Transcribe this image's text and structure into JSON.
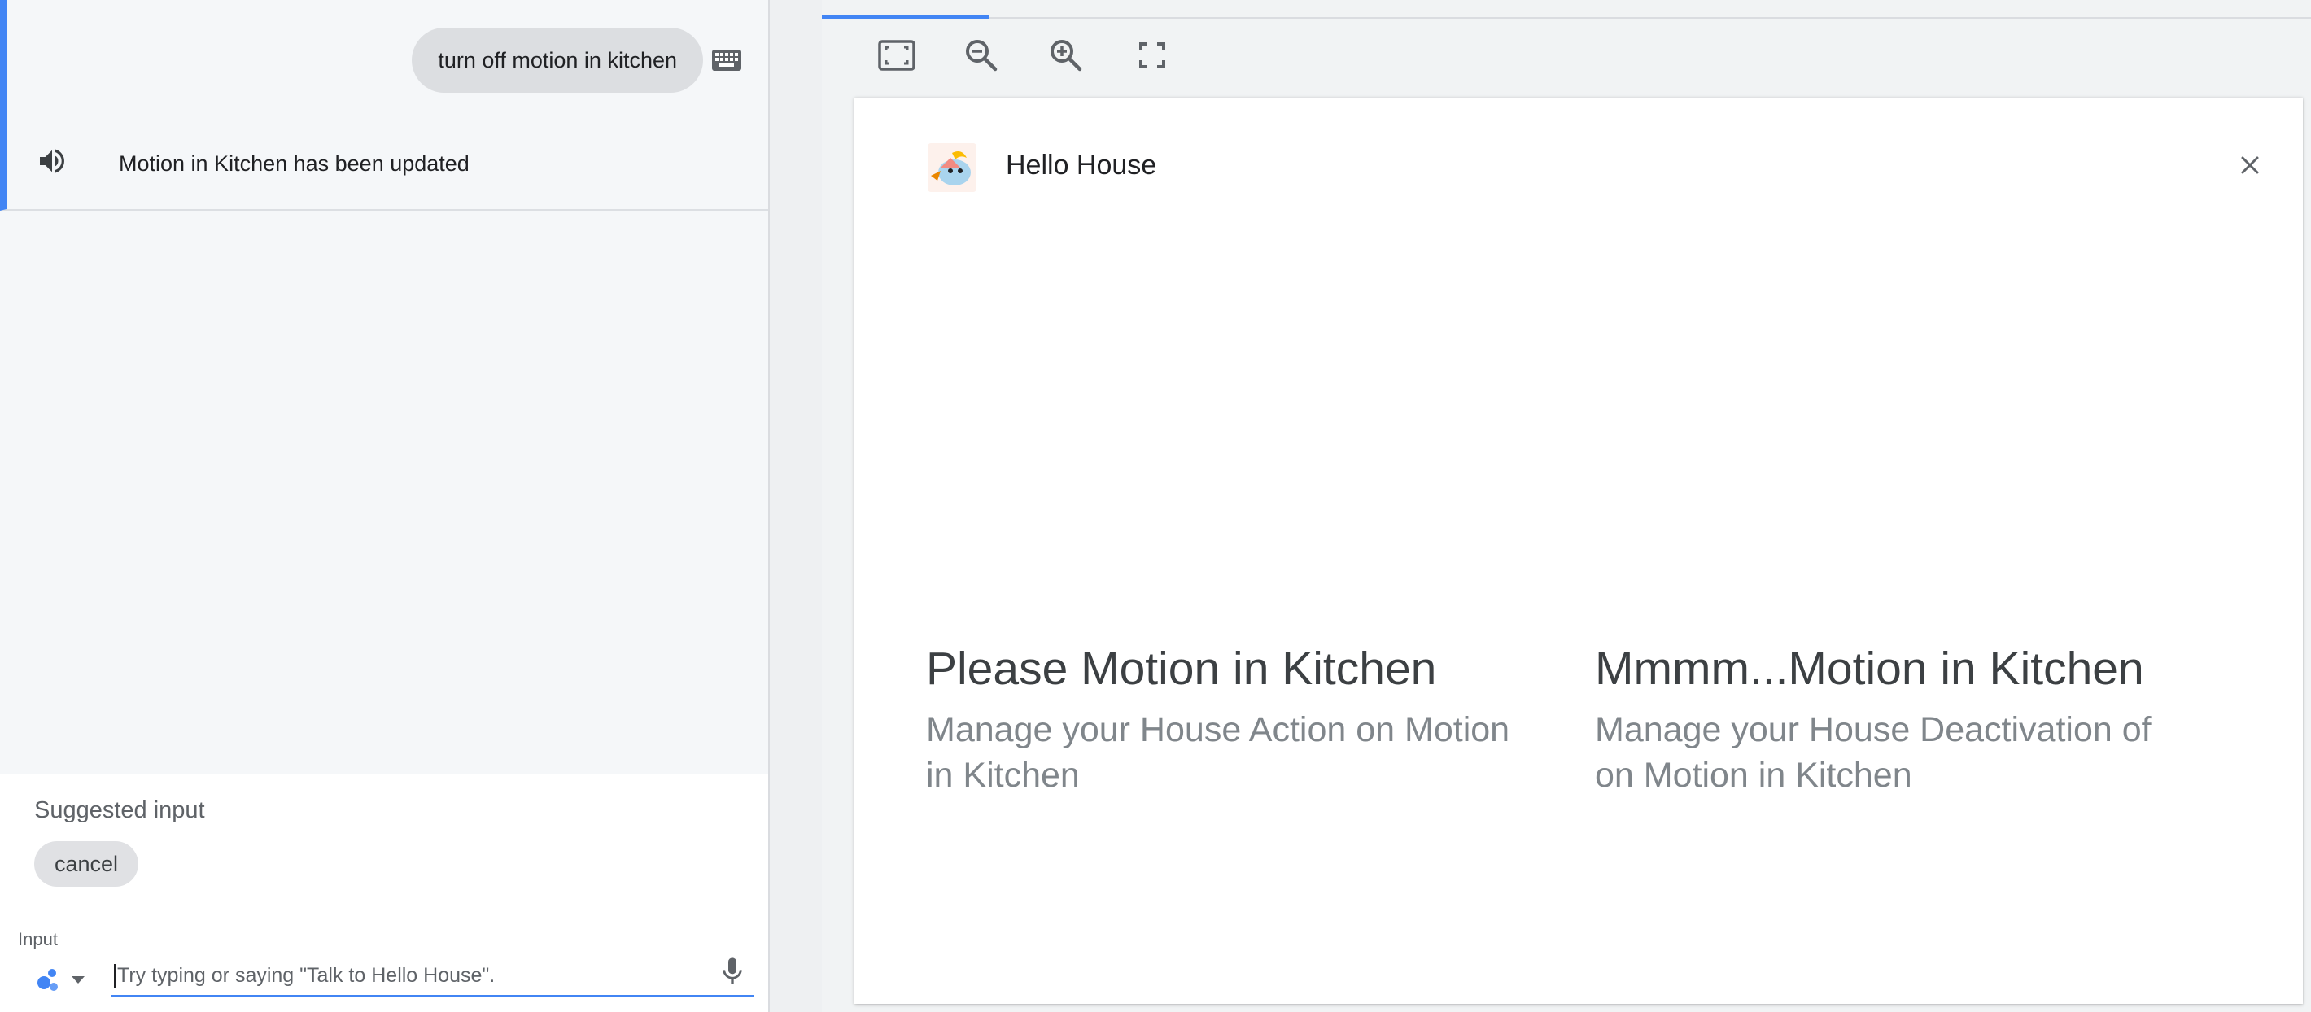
{
  "conversation": {
    "user_query": "turn off motion in kitchen",
    "response": "Motion in Kitchen has been updated"
  },
  "suggestions": {
    "label": "Suggested input",
    "chips": [
      "cancel"
    ]
  },
  "input": {
    "label": "Input",
    "placeholder": "Try typing or saying \"Talk to Hello House\".",
    "value": ""
  },
  "toolbar": {
    "icons": [
      "fit-screen-icon",
      "zoom-out-icon",
      "zoom-in-icon",
      "fullscreen-icon"
    ]
  },
  "display": {
    "app_name": "Hello House",
    "items": [
      {
        "title": "Please Motion in Kitchen",
        "description": "Manage your House Action on Motion in Kitchen"
      },
      {
        "title": "Mmmm...Motion in Kitchen",
        "description": "Manage your House Deactivation of on Motion in Kitchen"
      }
    ]
  },
  "colors": {
    "accent": "#4285f4",
    "user_bubble": "#dcdee1",
    "conversation_bg": "#f5f7f9"
  }
}
